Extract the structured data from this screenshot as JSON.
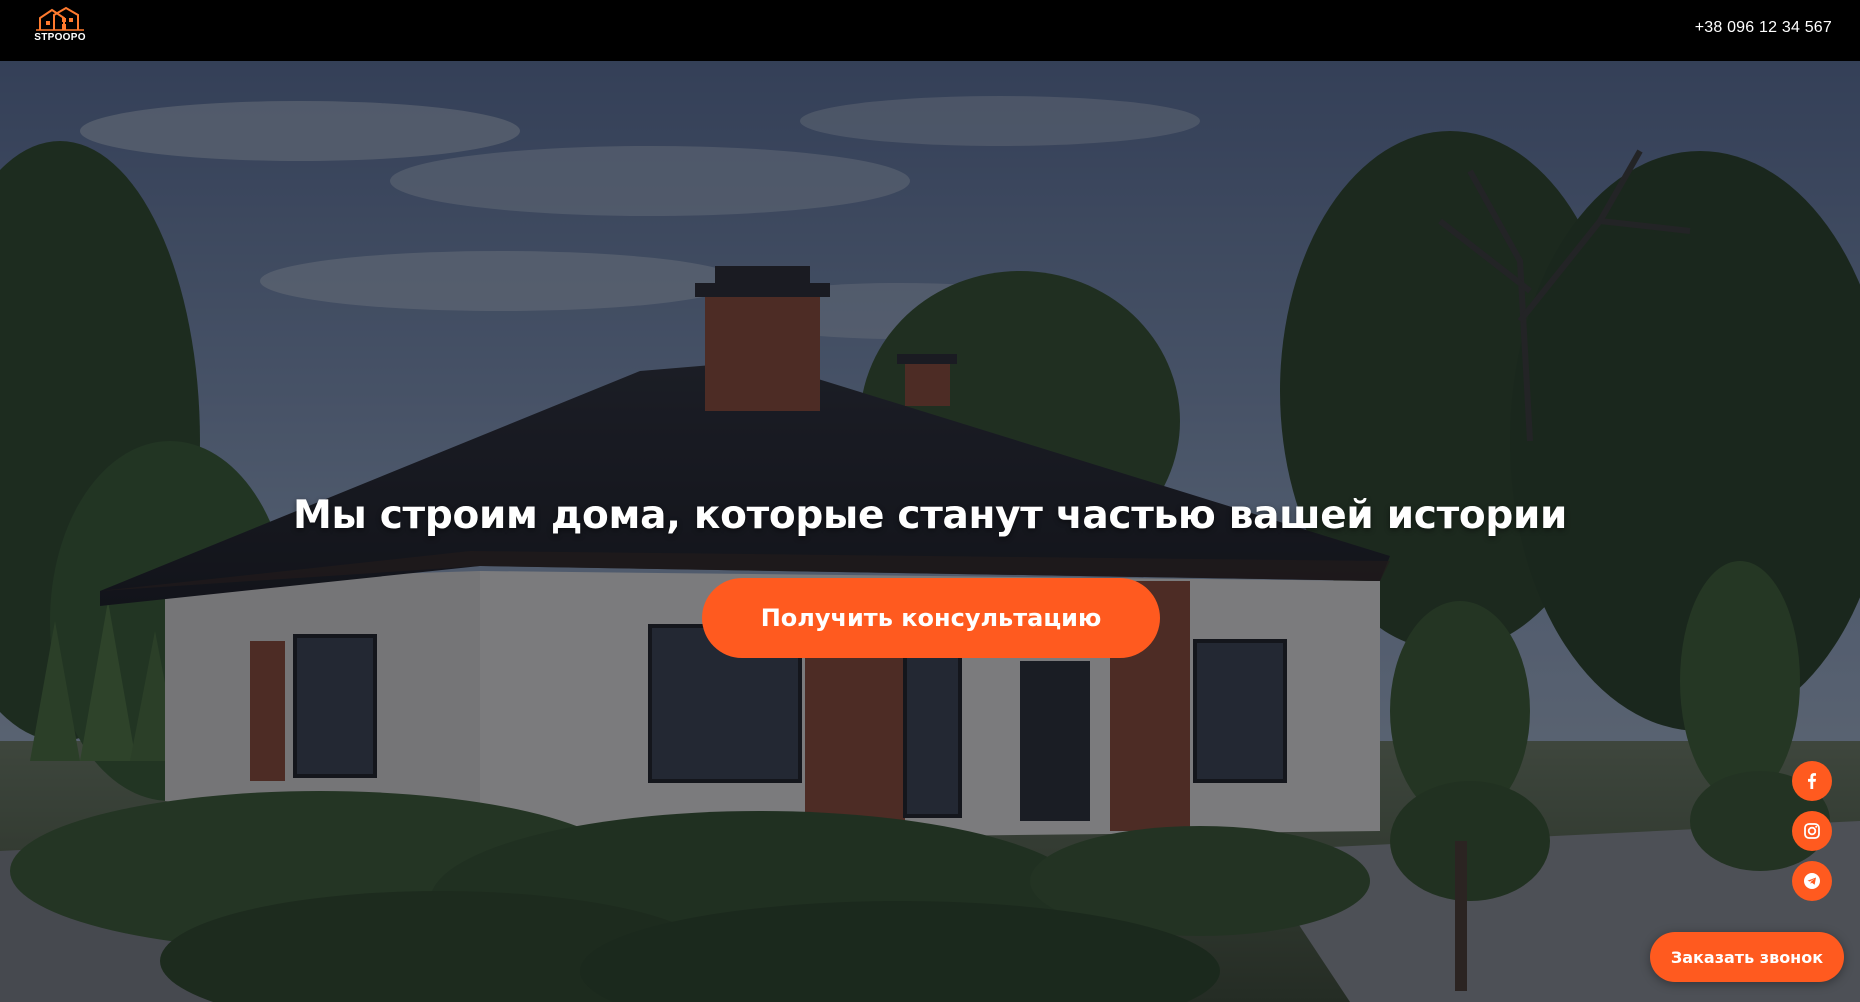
{
  "header": {
    "logo_text": "STPOOPO",
    "phone": "+38 096 12 34 567"
  },
  "hero": {
    "title": "Мы строим дома, которые станут частью вашей истории",
    "cta_label": "Получить консультацию"
  },
  "social": {
    "items": [
      {
        "name": "facebook",
        "icon": "facebook-icon"
      },
      {
        "name": "instagram",
        "icon": "instagram-icon"
      },
      {
        "name": "telegram",
        "icon": "telegram-icon"
      }
    ]
  },
  "callback": {
    "label": "Заказать звонок"
  },
  "colors": {
    "accent": "#ff5a1f",
    "header_bg": "#000000",
    "text": "#ffffff"
  }
}
